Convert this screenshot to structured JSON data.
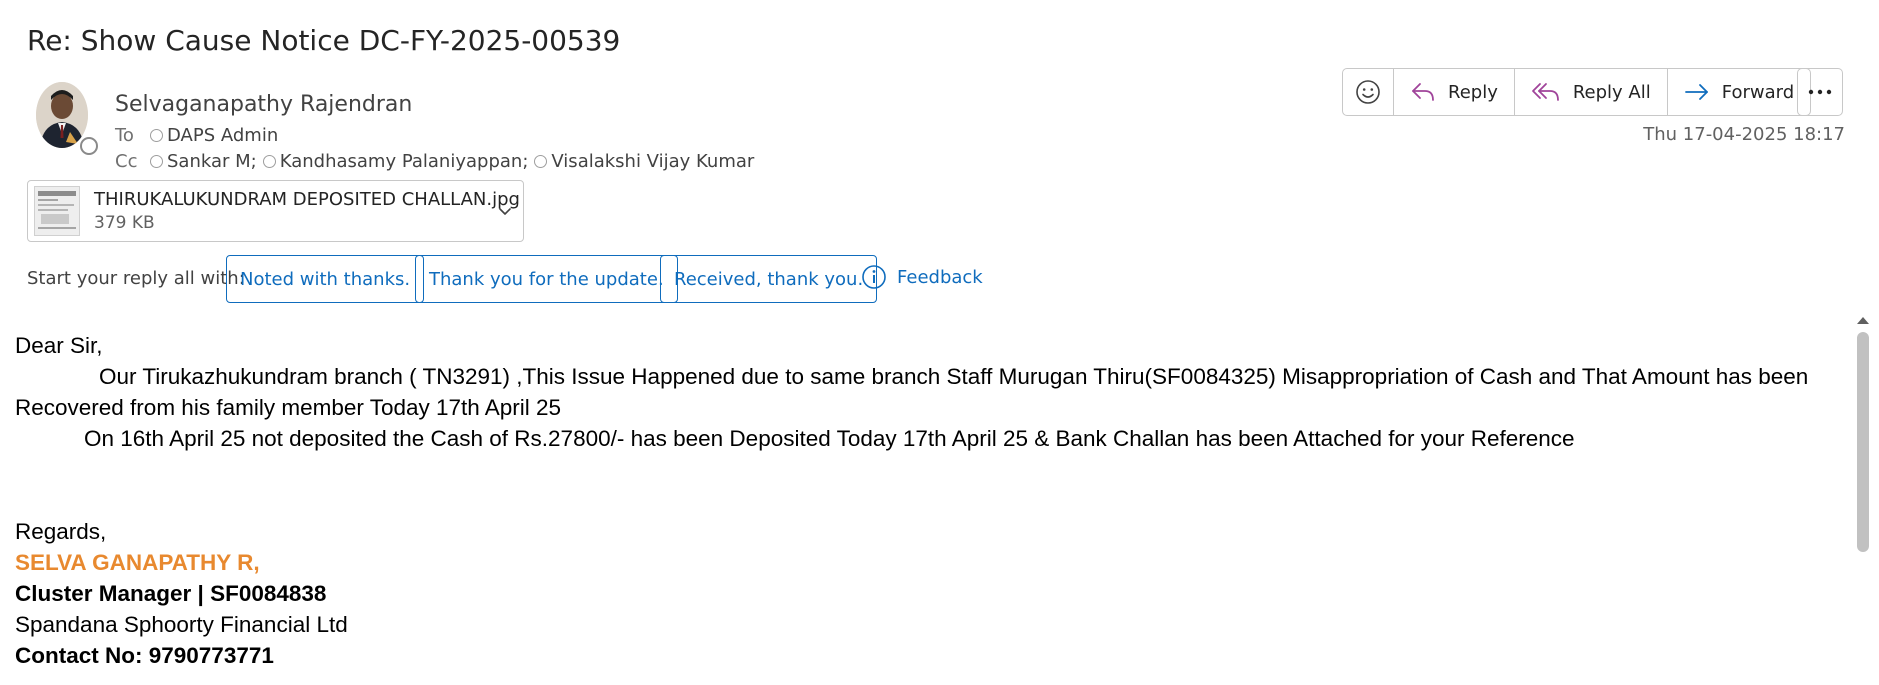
{
  "subject": "Re: Show Cause Notice DC-FY-2025-00539",
  "sender": "Selvaganapathy Rajendran",
  "to_label": "To",
  "cc_label": "Cc",
  "to_recipients": [
    "DAPS Admin"
  ],
  "cc_recipients": [
    "Sankar M;",
    "Kandhasamy Palaniyappan;",
    "Visalakshi Vijay Kumar"
  ],
  "date": "Thu 17-04-2025 18:17",
  "toolbar": {
    "reply": "Reply",
    "reply_all": "Reply All",
    "forward": "Forward",
    "emoji_icon": "emoji-icon",
    "more_icon": "more-icon"
  },
  "attachment": {
    "name": "THIRUKALUKUNDRAM DEPOSITED CHALLAN.jpg",
    "size": "379 KB"
  },
  "suggestions": {
    "label": "Start your reply all with:",
    "chips": [
      "Noted with thanks.",
      "Thank you for the update.",
      "Received, thank you."
    ],
    "feedback": "Feedback"
  },
  "body": {
    "greeting": "Dear Sir,",
    "para1_line1": "Our Tirukazhukundram  branch ( TN3291) ,This Issue Happened due to same branch Staff Murugan Thiru(SF0084325) Misappropriation of Cash and That Amount has been",
    "para1_line2": "Recovered from his family member Today 17th April 25",
    "para2": "On 16th April 25 not deposited the Cash of Rs.27800/- has been Deposited Today 17th April 25 & Bank Challan has been Attached for your Reference",
    "regards": "Regards,",
    "sig_name": "SELVA GANAPATHY R,",
    "sig_title": "Cluster Manager | SF0084838",
    "sig_company": "Spandana Sphoorty Financial Ltd",
    "sig_contact": "Contact No: 9790773771"
  },
  "colors": {
    "accent": "#0f6cbd",
    "reply_icon": "#a0449a",
    "forward_icon": "#0f6cbd",
    "signature_orange": "#e8892f"
  }
}
